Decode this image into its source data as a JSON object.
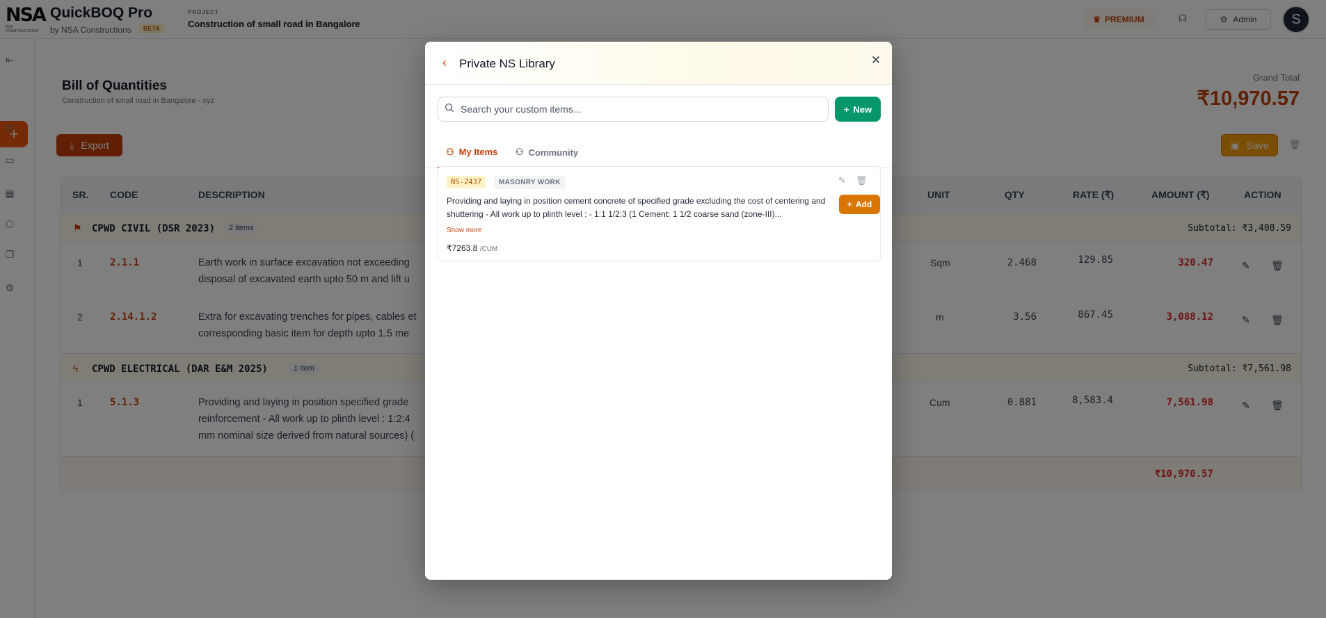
{
  "header": {
    "logo_text": "NSA",
    "logo_tagline": "NSA CONSTRUCTIONS",
    "app_name": "QuickBOQ Pro",
    "app_sub": "by NSA Constructions",
    "beta": "BETA",
    "project_label": "PROJECT",
    "project_name": "Construction of small road in Bangalore",
    "premium": "PREMIUM",
    "admin": "Admin",
    "avatar_initial": "S"
  },
  "boq": {
    "title": "Bill of Quantities",
    "subtitle": "Construction of small road in Bangalore - xyz",
    "grand_total_label": "Grand Total",
    "grand_total_value": "₹10,970.57",
    "export_label": "Export",
    "save_label": "Save",
    "columns": [
      "SR.",
      "CODE",
      "DESCRIPTION",
      "UNIT",
      "QTY",
      "RATE (₹)",
      "AMOUNT (₹)",
      "ACTION"
    ],
    "groups": [
      {
        "name": "CPWD CIVIL (DSR 2023)",
        "count": "2 items",
        "subtotal": "Subtotal: ₹3,408.59",
        "rows": [
          {
            "sr": "1",
            "code": "2.1.1",
            "desc_line1": "Earth work in surface excavation not exceeding",
            "desc_line2": "disposal of excavated earth upto 50 m and lift u",
            "unit": "Sqm",
            "qty": "2.468",
            "rate": "129.85",
            "amount": "320.47"
          },
          {
            "sr": "2",
            "code": "2.14.1.2",
            "desc_line1": "Extra for excavating trenches for pipes, cables et",
            "desc_line2": "corresponding basic item for depth upto 1.5 me",
            "unit": "m",
            "qty": "3.56",
            "rate": "867.45",
            "amount": "3,088.12"
          }
        ]
      },
      {
        "name": "CPWD ELECTRICAL (DAR E&M 2025)",
        "count": "1 item",
        "subtotal": "Subtotal: ₹7,561.98",
        "rows": [
          {
            "sr": "1",
            "code": "5.1.3",
            "desc_line1": "Providing and laying in position specified grade",
            "desc_line2": "reinforcement - All work up to plinth level : 1:2:4",
            "desc_line3": "mm nominal size derived from natural sources) (",
            "unit": "Cum",
            "qty": "0.881",
            "rate": "8,583.4",
            "amount": "7,561.98"
          }
        ]
      }
    ],
    "footer_total": "₹10,970.57"
  },
  "modal": {
    "title": "Private NS Library",
    "search_placeholder": "Search your custom items...",
    "new_label": "New",
    "tabs": [
      {
        "label": "My Items"
      },
      {
        "label": "Community"
      }
    ],
    "item": {
      "code": "NS-2437",
      "category": "MASONRY WORK",
      "description": "Providing and laying in position cement concrete of specified grade excluding the cost of centering and shuttering - All work up to plinth level : - 1:1 1/2:3 (1 Cement: 1 1/2 coarse sand (zone-III)...",
      "show_more": "Show more",
      "price": "₹7263.8",
      "unit": "/CUM",
      "add_label": "Add"
    }
  },
  "colors": {
    "accent": "#c2410c",
    "new_button": "#059669",
    "add_button": "#d97706"
  }
}
